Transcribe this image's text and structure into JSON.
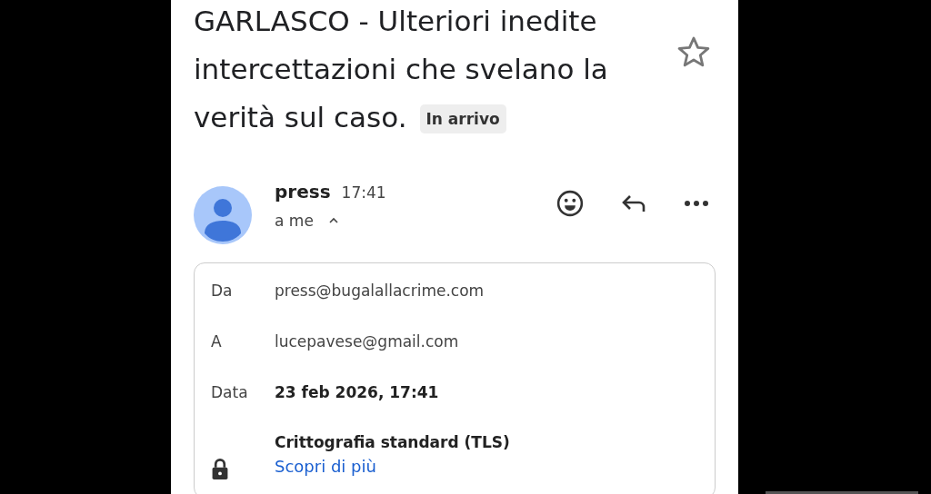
{
  "subject": {
    "title_lines": [
      "GARLASCO - Ulteriori inedite",
      "intercettazioni che svelano la",
      "verità sul caso."
    ],
    "label": "In arrivo",
    "starred": false
  },
  "message": {
    "sender": "press",
    "time": "17:41",
    "recipient": "a me",
    "details_expanded": true
  },
  "details": [
    {
      "kind": "field",
      "label": "Da",
      "value": "press@bugalallacrime.com",
      "strong": false
    },
    {
      "kind": "field",
      "label": "A",
      "value": "lucepavese@gmail.com",
      "strong": false
    },
    {
      "kind": "field",
      "label": "Data",
      "value": "23 feb 2026, 17:41",
      "strong": true
    },
    {
      "kind": "security",
      "value": "Crittografia standard (TLS)",
      "link": "Scopri di più"
    }
  ]
}
